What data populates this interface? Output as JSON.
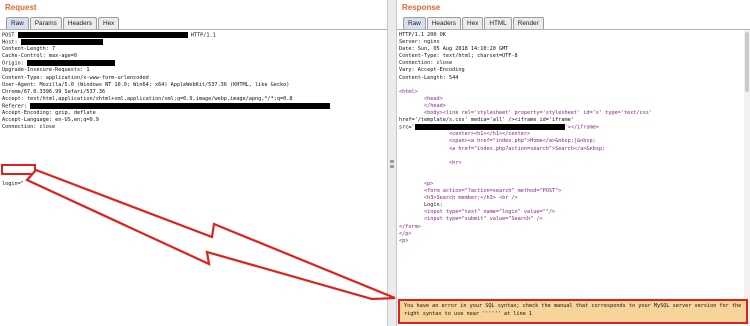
{
  "request": {
    "title": "Request",
    "tabs": [
      "Raw",
      "Params",
      "Headers",
      "Hex"
    ],
    "active_tab": "Raw",
    "lines": [
      {
        "pre": "POST ",
        "redact": 170,
        "post": " HTTP/1.1"
      },
      {
        "pre": "Host: ",
        "redact": 82,
        "post": ""
      },
      {
        "pre": "Content-Length: 7",
        "redact": 0,
        "post": ""
      },
      {
        "pre": "Cache-Control: max-age=0",
        "redact": 0,
        "post": ""
      },
      {
        "pre": "Origin: ",
        "redact": 88,
        "post": ""
      },
      {
        "pre": "Upgrade-Insecure-Requests: 1",
        "redact": 0,
        "post": ""
      },
      {
        "pre": "Content-Type: application/x-www-form-urlencoded",
        "redact": 0,
        "post": ""
      },
      {
        "pre": "User-Agent: Mozilla/5.0 (Windows NT 10.0; Win64; x64) AppleWebKit/537.36 (KHTML, like Gecko)",
        "redact": 0,
        "post": ""
      },
      {
        "pre": "Chrome/67.0.3396.99 Safari/537.36",
        "redact": 0,
        "post": ""
      },
      {
        "pre": "Accept: text/html,application/xhtml+xml,application/xml;q=0.9,image/webp,image/apng,*/*;q=0.8",
        "redact": 0,
        "post": ""
      },
      {
        "pre": "Referer: ",
        "redact": 300,
        "post": ""
      },
      {
        "pre": "Accept-Encoding: gzip, deflate",
        "redact": 0,
        "post": ""
      },
      {
        "pre": "Accept-Language: en-US,en;q=0.9",
        "redact": 0,
        "post": ""
      },
      {
        "pre": "Connection: close",
        "redact": 0,
        "post": ""
      },
      {
        "pre": "",
        "redact": 0,
        "post": ""
      },
      {
        "pre": "",
        "redact": 0,
        "post": ""
      },
      {
        "pre": "",
        "redact": 0,
        "post": ""
      }
    ],
    "body_text": "login=\""
  },
  "response": {
    "title": "Response",
    "tabs": [
      "Raw",
      "Headers",
      "Hex",
      "HTML",
      "Render"
    ],
    "active_tab": "Raw",
    "header_lines": [
      "HTTP/1.1 200 OK",
      "Server: nginx",
      "Date: Sun, 05 Aug 2018 14:10:20 GMT",
      "Content-Type: text/html; charset=UTF-8",
      "Connection: close",
      "Vary: Accept-Encoding",
      "Content-Length: 544"
    ],
    "html_lines": [
      "",
      "<html>",
      "        <head>",
      "        </head>",
      "        <body><link rel='stylesheet' property='stylesheet' id='s' type='text/css'",
      "href='/template/s.css' media='all' /><iframe id='iframe'",
      "src='",
      "                <center><h1></h1></center>",
      "                <span><a href=\"index.php\">Home</a>&nbsp;|&nbsp;",
      "                <a href=\"index.php?action=search\">Search</a>&nbsp;",
      "",
      "                <hr>",
      "",
      "",
      "        <p>",
      "        <form action=\"?action=search\" method=\"POST\">",
      "        <h3>Search member:</h3> <br />",
      "        Login:",
      "        <input type=\"text\" name=\"login\" value=\"\"/>",
      "        <input type=\"submit\" value=\"Search\" />",
      "</form>",
      "</p>",
      "<p>"
    ],
    "src_tail": "'></iframe>",
    "error_text": "You have an error in your SQL syntax; check the manual that corresponds to your MySQL server version for the right syntax to use near '''''' at line 1"
  }
}
